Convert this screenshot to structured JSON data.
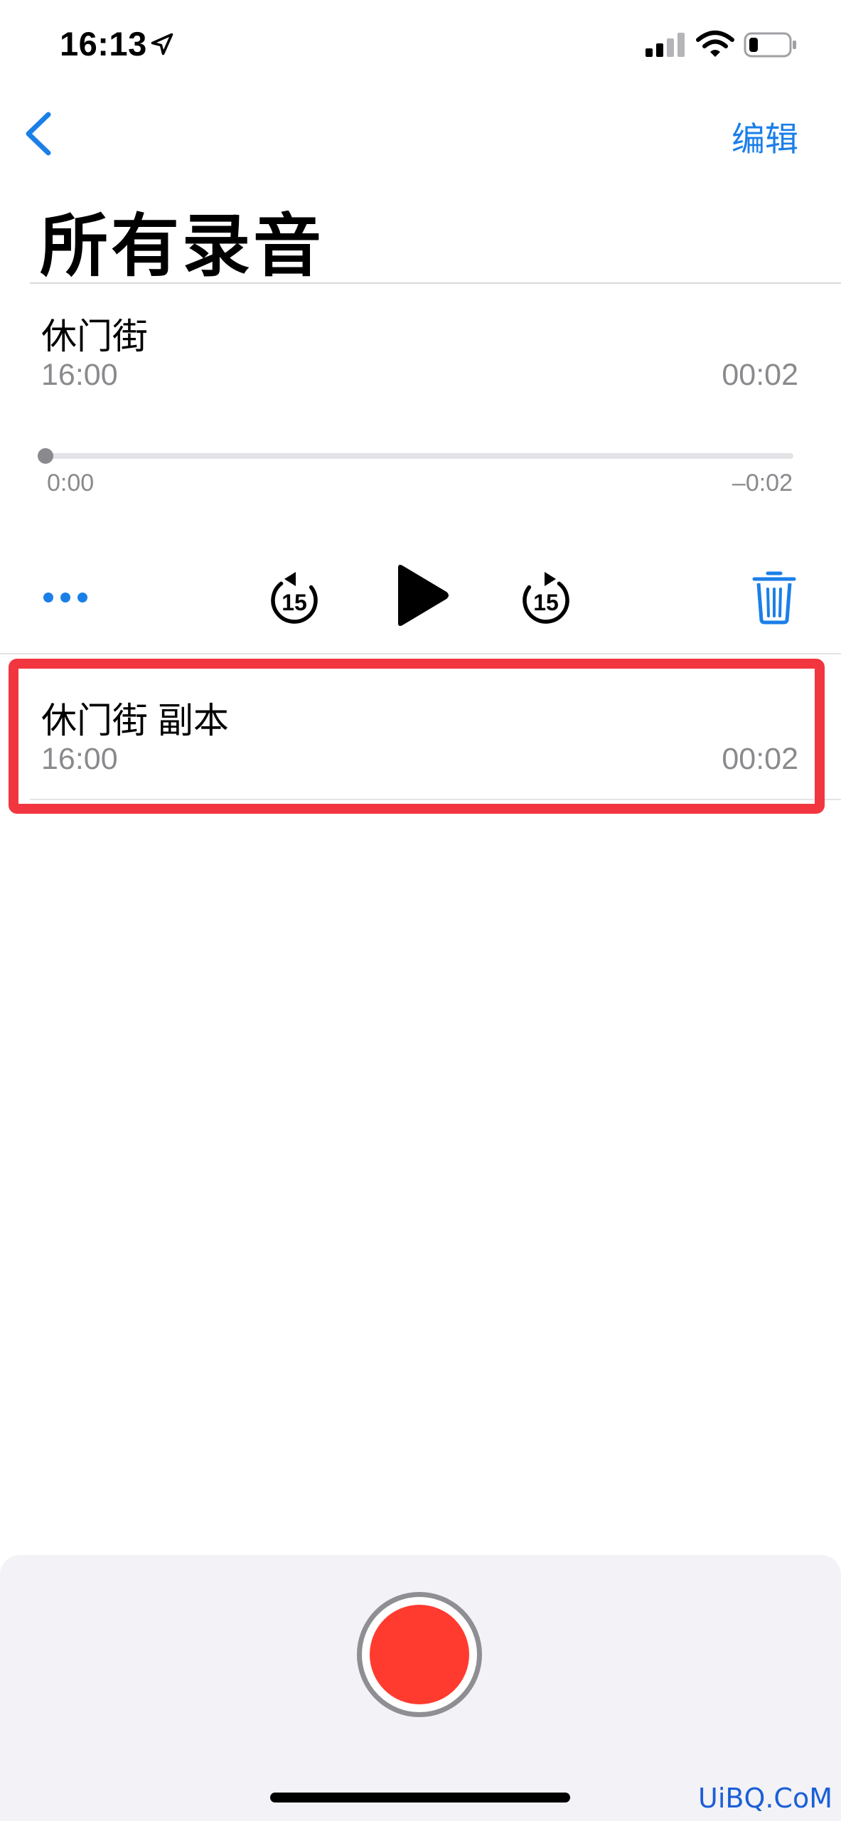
{
  "status_bar": {
    "time": "16:13"
  },
  "nav": {
    "edit_label": "编辑"
  },
  "page": {
    "title": "所有录音"
  },
  "recordings": [
    {
      "name": "休门街",
      "time": "16:00",
      "duration": "00:02"
    },
    {
      "name": "休门街 副本",
      "time": "16:00",
      "duration": "00:02"
    }
  ],
  "player": {
    "elapsed": "0:00",
    "remaining": "–0:02",
    "progress": 0.0,
    "skip_seconds": "15"
  },
  "colors": {
    "accent": "#1b7fe8",
    "record": "#ff3b30",
    "highlight": "#f23640"
  },
  "watermark": "UiBQ.CoM"
}
